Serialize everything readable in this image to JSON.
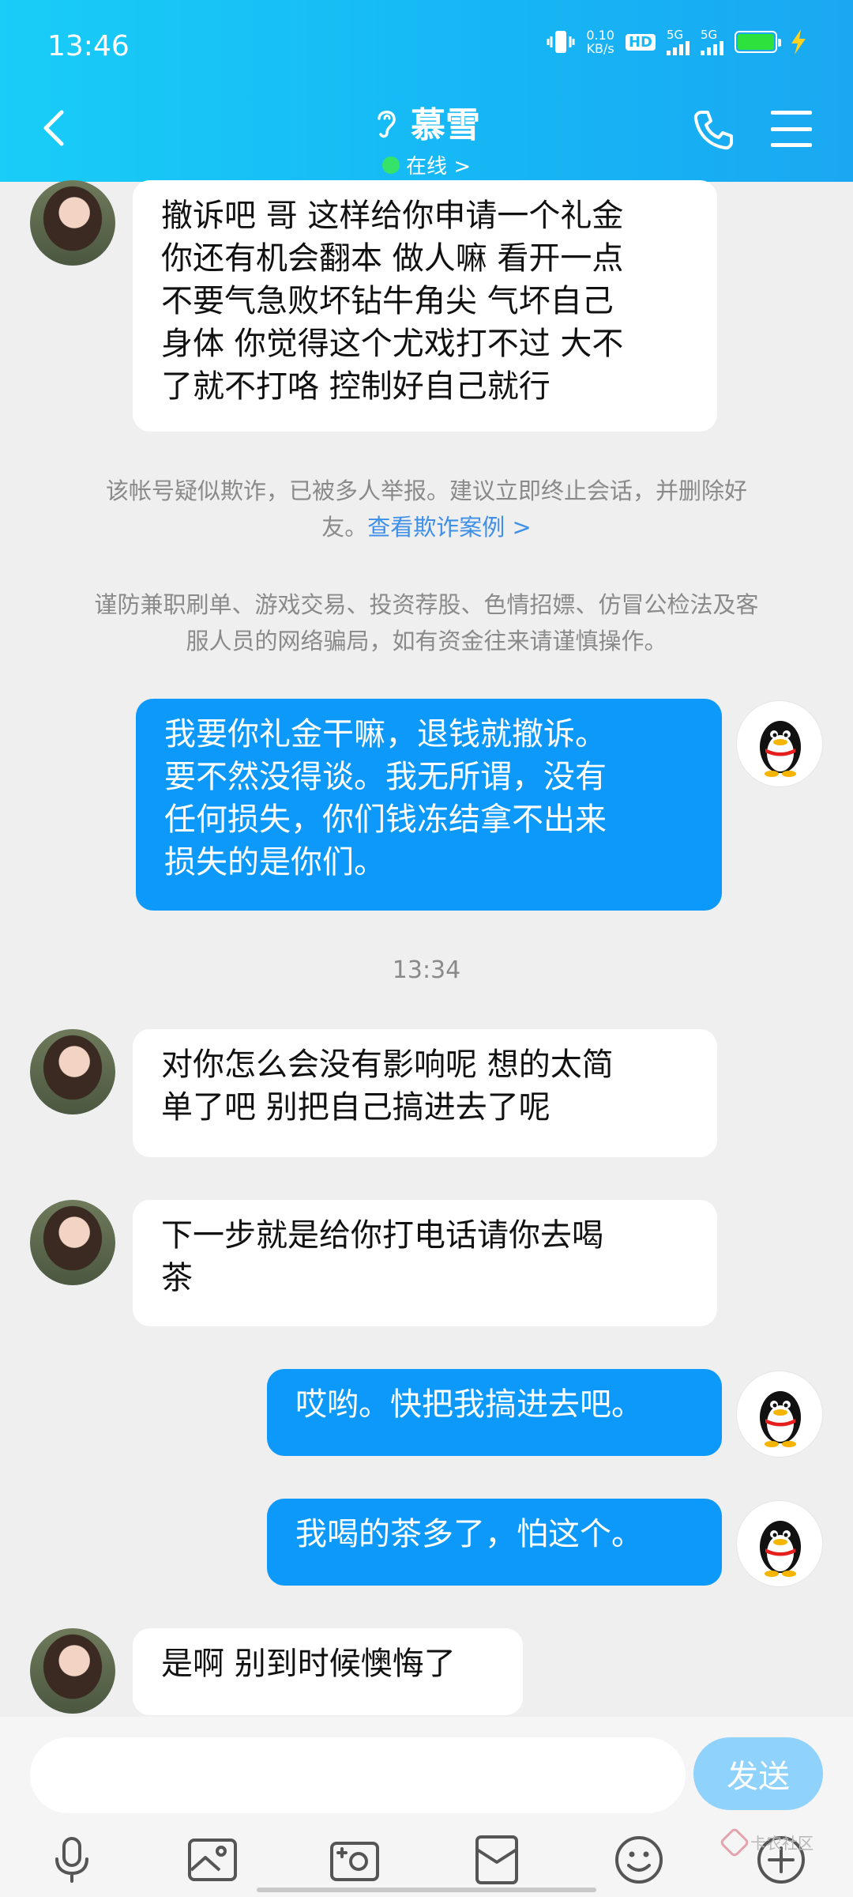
{
  "status_bar": {
    "time": "13:46",
    "net_speed_value": "0.10",
    "net_speed_unit": "KB/s",
    "hd_label": "HD",
    "sim1_label": "5G",
    "sim2_label": "5G",
    "battery_level": 1.0
  },
  "header": {
    "title": "慕雪",
    "status": "在线 >"
  },
  "messages": [
    {
      "side": "in",
      "text_lines": [
        "撤诉吧 哥 这样给你申请一个礼金",
        "你还有机会翻本 做人嘛 看开一点",
        "不要气急败坏钻牛角尖 气坏自己",
        "身体 你觉得这个尤戏打不过 大不",
        "了就不打咯 控制好自己就行"
      ]
    },
    {
      "side": "out",
      "text_lines": [
        "我要你礼金干嘛，退钱就撤诉。",
        "要不然没得谈。我无所谓，没有",
        "任何损失，你们钱冻结拿不出来",
        "损失的是你们。"
      ]
    },
    {
      "side": "in",
      "text_lines": [
        "对你怎么会没有影响呢 想的太简",
        "单了吧 别把自己搞进去了呢"
      ]
    },
    {
      "side": "in",
      "text_lines": [
        "下一步就是给你打电话请你去喝",
        "茶"
      ]
    },
    {
      "side": "out",
      "text_lines": [
        "哎哟。快把我搞进去吧。"
      ]
    },
    {
      "side": "out",
      "text_lines": [
        "我喝的茶多了，怕这个。"
      ]
    },
    {
      "side": "in",
      "text_lines": [
        "是啊 别到时候懊悔了"
      ]
    }
  ],
  "notices": {
    "fraud_warning_line1": "该帐号疑似欺诈，已被多人举报。建议立即终止会话，并删除好",
    "fraud_warning_line2": "友。",
    "fraud_link": "查看欺诈案例 >",
    "scam_tips_line1": "谨防兼职刷单、游戏交易、投资荐股、色情招嫖、仿冒公检法及客",
    "scam_tips_line2": "服人员的网络骗局，如有资金往来请谨慎操作。"
  },
  "timestamp": "13:34",
  "input": {
    "placeholder": "",
    "send_label": "发送"
  },
  "toolbar_icons": [
    "microphone-icon",
    "image-icon",
    "camera-icon",
    "red-packet-icon",
    "emoji-icon",
    "plus-icon"
  ],
  "watermark": {
    "text": "卡农社区"
  },
  "colors": {
    "header_gradient_start": "#19cdf7",
    "header_gradient_end": "#1aa8f2",
    "outgoing_bubble": "#0d99fa",
    "incoming_bubble": "#ffffff",
    "send_button": "#8fd2fb",
    "link": "#3d8fe8",
    "online_dot": "#35e36a"
  }
}
